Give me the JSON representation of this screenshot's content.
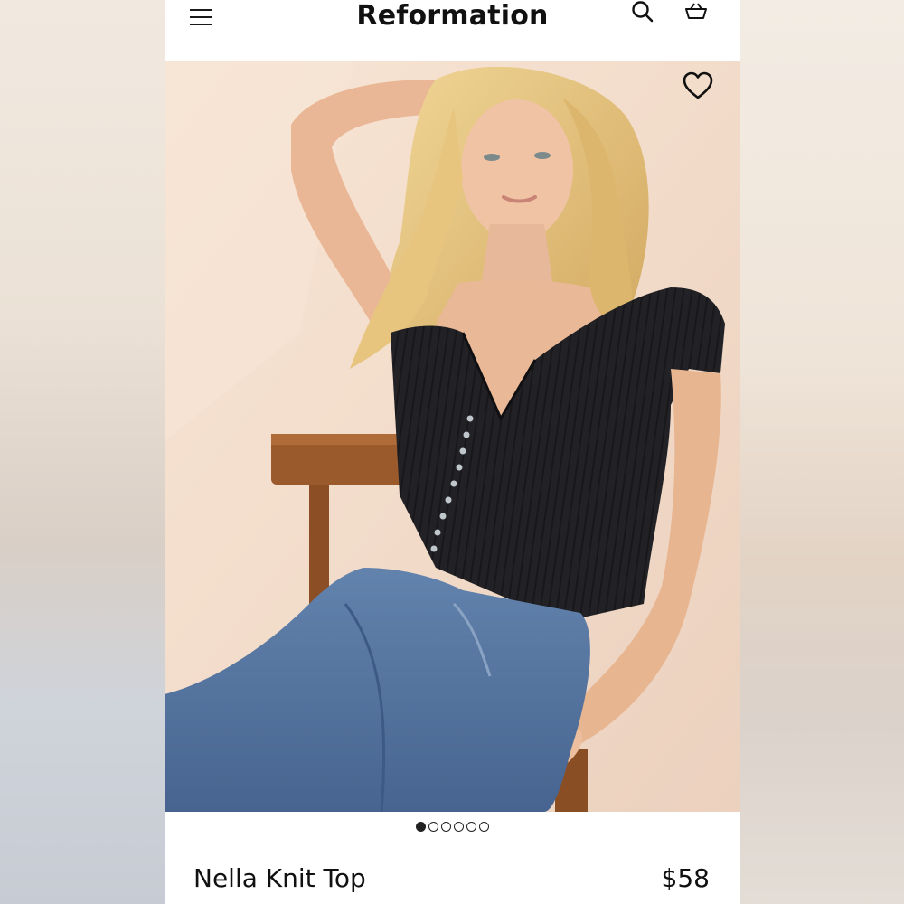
{
  "header": {
    "brand": "Reformation",
    "menu_icon": "hamburger-menu-icon",
    "search_icon": "search-icon",
    "cart_icon": "shopping-basket-icon"
  },
  "product_image": {
    "description_icon": "product-photo",
    "wishlist_icon": "heart-icon",
    "carousel": {
      "total": 6,
      "active_index": 0
    }
  },
  "product": {
    "name": "Nella Knit Top",
    "price": "$58"
  },
  "colors": {
    "top": "#1f1f22",
    "denim": "#4f6f99",
    "skin": "#e8b89a",
    "hair": "#e2c07a",
    "chair": "#9b5a2c",
    "backdrop": "#f3dccb"
  }
}
